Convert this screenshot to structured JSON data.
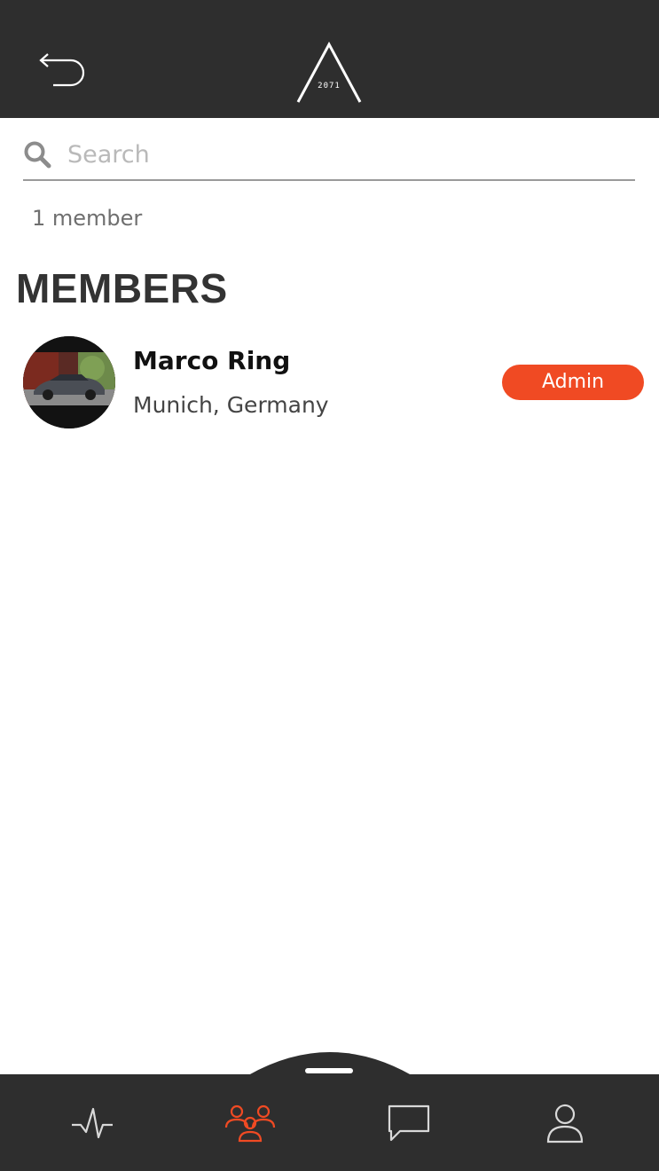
{
  "header": {
    "back_icon": "back-arrow-icon",
    "logo_year": "2071"
  },
  "search": {
    "placeholder": "Search",
    "value": "",
    "icon": "search-icon"
  },
  "member_count": "1 member",
  "section_title": "MEMBERS",
  "members": [
    {
      "name": "Marco Ring",
      "location": "Munich, Germany",
      "role": "Admin",
      "avatar": "car-photo"
    }
  ],
  "colors": {
    "header_bg": "#2e2e2e",
    "accent": "#f04a23",
    "tab_active": "#f04a23",
    "tab_inactive": "#d8d8d8"
  },
  "tabbar": {
    "tabs": [
      {
        "icon": "activity-icon",
        "active": false
      },
      {
        "icon": "members-icon",
        "active": true
      },
      {
        "icon": "chat-icon",
        "active": false
      },
      {
        "icon": "profile-icon",
        "active": false
      }
    ]
  }
}
